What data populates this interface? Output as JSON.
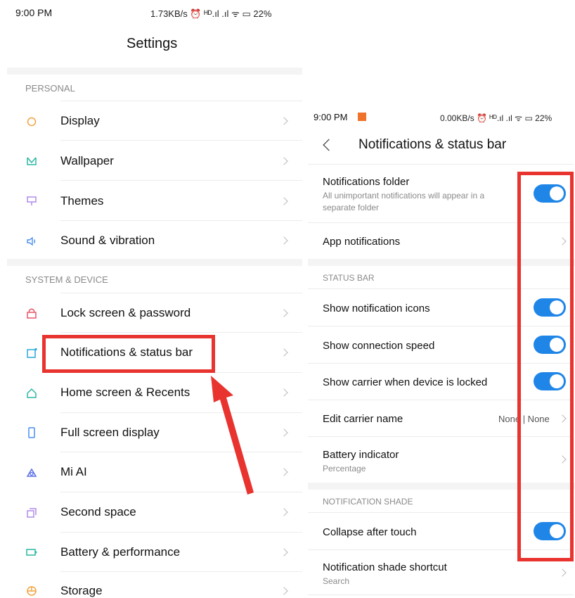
{
  "colors": {
    "accent": "#1f86e8",
    "highlight": "#e8332e"
  },
  "left": {
    "status": {
      "time": "9:00 PM",
      "right": "1.73KB/s ⏰ ᴴᴰ.ıl .ıl ᯤ ▭ 22%"
    },
    "title": "Settings",
    "section_personal": "PERSONAL",
    "section_system": "SYSTEM & DEVICE",
    "items": [
      {
        "label": "Display",
        "icon": "display-icon"
      },
      {
        "label": "Wallpaper",
        "icon": "wallpaper-icon"
      },
      {
        "label": "Themes",
        "icon": "themes-icon"
      },
      {
        "label": "Sound & vibration",
        "icon": "sound-icon"
      },
      {
        "label": "Lock screen & password",
        "icon": "lock-icon"
      },
      {
        "label": "Notifications & status bar",
        "icon": "notifications-icon"
      },
      {
        "label": "Home screen & Recents",
        "icon": "home-icon"
      },
      {
        "label": "Full screen display",
        "icon": "fullscreen-icon"
      },
      {
        "label": "Mi AI",
        "icon": "mi-ai-icon"
      },
      {
        "label": "Second space",
        "icon": "second-space-icon"
      },
      {
        "label": "Battery & performance",
        "icon": "battery-icon"
      },
      {
        "label": "Storage",
        "icon": "storage-icon"
      }
    ]
  },
  "right": {
    "status": {
      "time": "9:00 PM",
      "right": "0.00KB/s ⏰ ᴴᴰ.ıl .ıl ᯤ ▭ 22%"
    },
    "title": "Notifications & status bar",
    "folder": {
      "label": "Notifications folder",
      "sub": "All unimportant notifications will appear in a",
      "sub2": "separate folder"
    },
    "app_notifications": "App notifications",
    "section_status": "STATUS BAR",
    "show_icons": "Show notification icons",
    "show_speed": "Show connection speed",
    "show_carrier": "Show carrier when device is locked",
    "edit_carrier": {
      "label": "Edit carrier name",
      "value": "None | None"
    },
    "battery": {
      "label": "Battery indicator",
      "sub": "Percentage"
    },
    "section_shade": "NOTIFICATION SHADE",
    "collapse": "Collapse after touch",
    "shade_shortcut": {
      "label": "Notification shade shortcut",
      "sub": "Search"
    }
  }
}
